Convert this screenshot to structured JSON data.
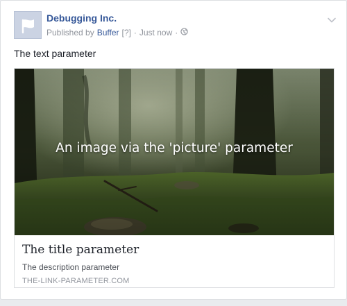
{
  "post": {
    "page_name": "Debugging Inc.",
    "byline": {
      "published_by": "Published by",
      "app_name": "Buffer",
      "help_marker": "[?]",
      "separator": "·",
      "timestamp": "Just now",
      "separator2": "·",
      "privacy_icon": "globe-icon"
    },
    "menu_icon": "chevron-down-icon",
    "text": "The text parameter"
  },
  "attachment": {
    "image_caption": "An image via the 'picture' parameter",
    "title": "The title parameter",
    "description": "The description parameter",
    "domain": "THE-LINK-PARAMETER.COM"
  },
  "colors": {
    "link_blue": "#365899",
    "meta_gray": "#90949c",
    "text_dark": "#1d2129",
    "feed_background": "#e9ebee"
  }
}
